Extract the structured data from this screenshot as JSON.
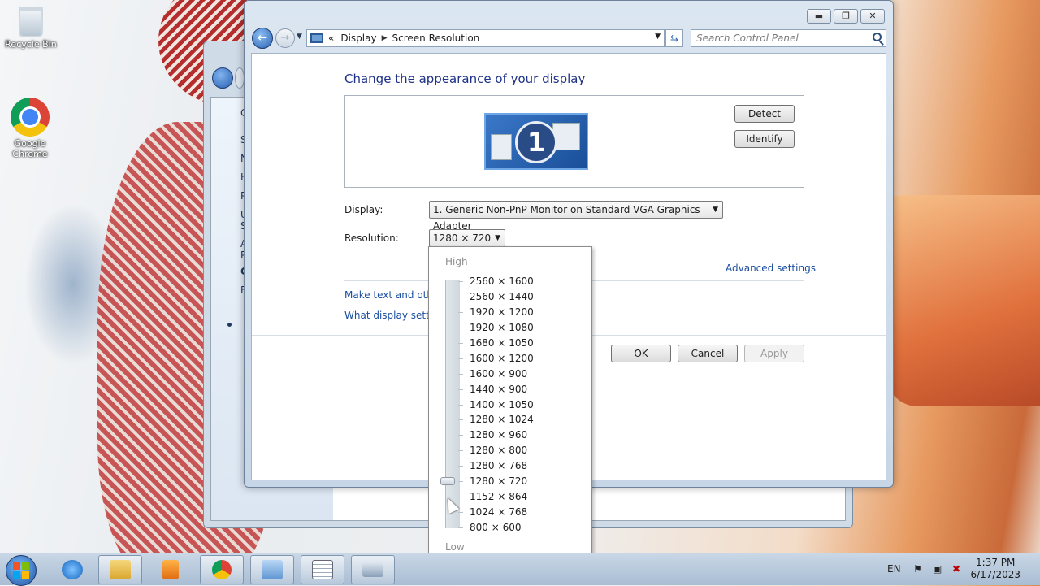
{
  "desktop": {
    "icons": [
      {
        "label": "Recycle Bin"
      },
      {
        "label": "Google Chrome"
      }
    ]
  },
  "back_window": {
    "sidebar": [
      "Co",
      "Sy",
      "Ne",
      "Ha",
      "Pr",
      "Us",
      "Sa",
      "Ap",
      "Pe",
      "Cl",
      "Ea"
    ]
  },
  "window": {
    "controls": {
      "minimize": "▬",
      "maximize": "❐",
      "close": "✕"
    },
    "nav": {
      "back": "←",
      "forward": "→",
      "history": "▼"
    },
    "breadcrumb": {
      "root": "«",
      "parent": "Display",
      "current": "Screen Resolution",
      "sep": "▶",
      "drop": "▼"
    },
    "refresh": "⇆",
    "search": {
      "placeholder": "Search Control Panel"
    },
    "heading": "Change the appearance of your display",
    "monitor_number": "1",
    "detect_label": "Detect",
    "identify_label": "Identify",
    "display_label": "Display:",
    "display_value": "1. Generic Non-PnP Monitor on Standard VGA Graphics Adapter",
    "resolution_label": "Resolution:",
    "resolution_value": "1280 × 720",
    "advanced_link": "Advanced settings",
    "link1": "Make text and other",
    "link2": "What display setting",
    "ok_label": "OK",
    "cancel_label": "Cancel",
    "apply_label": "Apply",
    "apply_enabled": false
  },
  "resolution_dropdown": {
    "high_label": "High",
    "low_label": "Low",
    "options": [
      "2560 × 1600",
      "2560 × 1440",
      "1920 × 1200",
      "1920 × 1080",
      "1680 × 1050",
      "1600 × 1200",
      "1600 × 900",
      "1440 × 900",
      "1400 × 1050",
      "1280 × 1024",
      "1280 × 960",
      "1280 × 800",
      "1280 × 768",
      "1280 × 720",
      "1152 × 864",
      "1024 × 768",
      "800 × 600"
    ],
    "selected_index": 13
  },
  "taskbar": {
    "language": "EN",
    "time": "1:37 PM",
    "date": "6/17/2023"
  },
  "colors": {
    "heading": "#1e3287",
    "link": "#1c4fa0",
    "accent": "#2b61b0"
  }
}
